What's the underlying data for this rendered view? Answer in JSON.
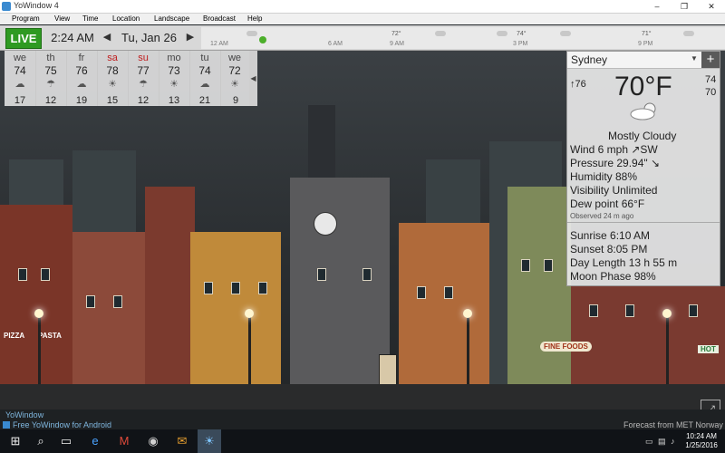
{
  "window": {
    "title": "YoWindow 4",
    "minimize": "–",
    "maximize": "❐",
    "close": "✕"
  },
  "menu": [
    "Program",
    "View",
    "Time",
    "Location",
    "Landscape",
    "Broadcast",
    "Help"
  ],
  "timebar": {
    "live_label": "LIVE",
    "time": "2:24 AM",
    "date": "Tu, Jan 26",
    "prev": "◀",
    "next": "▶",
    "hours": [
      "12 AM",
      "6 AM",
      "9 AM",
      "3 PM",
      "9 PM"
    ],
    "temps": [
      "72°",
      "74°",
      "71°"
    ]
  },
  "forecast": {
    "days": [
      {
        "name": "we",
        "temp": "74",
        "wind": "17",
        "weekend": false,
        "icon": "cloud-icon"
      },
      {
        "name": "th",
        "temp": "75",
        "wind": "12",
        "weekend": false,
        "icon": "rain-cloud-icon"
      },
      {
        "name": "fr",
        "temp": "76",
        "wind": "19",
        "weekend": false,
        "icon": "cloud-icon"
      },
      {
        "name": "sa",
        "temp": "78",
        "wind": "15",
        "weekend": true,
        "icon": "sun-cloud-icon"
      },
      {
        "name": "su",
        "temp": "77",
        "wind": "12",
        "weekend": true,
        "icon": "rain-cloud-icon"
      },
      {
        "name": "mo",
        "temp": "73",
        "wind": "13",
        "weekend": false,
        "icon": "sun-cloud-icon"
      },
      {
        "name": "tu",
        "temp": "74",
        "wind": "21",
        "weekend": false,
        "icon": "cloud-icon"
      },
      {
        "name": "we",
        "temp": "72",
        "wind": "9",
        "weekend": false,
        "icon": "sun-cloud-icon"
      }
    ],
    "scroll_arrow": "◀"
  },
  "current": {
    "city": "Sydney",
    "dropdown": "▼",
    "add": "+",
    "feels": "76",
    "temp": "70°F",
    "hi": "74",
    "lo": "70",
    "condition": "Mostly Cloudy",
    "wind": "Wind  6 mph ↗SW",
    "pressure": "Pressure  29.94\" ↘",
    "humidity": "Humidity  88%",
    "visibility": "Visibility  Unlimited",
    "dew": "Dew point  66°F",
    "observed": "Observed  24 m ago",
    "sunrise": "Sunrise  6:10 AM",
    "sunset": "Sunset  8:05 PM",
    "day_length": "Day Length  13 h 55 m",
    "moon_phase": "Moon Phase  98%"
  },
  "scene": {
    "signs": [
      "PIZZA",
      "PASTA",
      "FINE FOODS",
      "HOT"
    ]
  },
  "status": {
    "brand": "YoWindow",
    "promo": "Free YoWindow for Android",
    "forecast_source": "Forecast from MET Norway",
    "fullscreen": "⤢"
  },
  "taskbar": {
    "time": "10:24 AM",
    "date": "1/25/2016"
  },
  "colors": {
    "live": "#2f9a22",
    "weekend": "#c02020",
    "accent": "#3a8ad0"
  }
}
